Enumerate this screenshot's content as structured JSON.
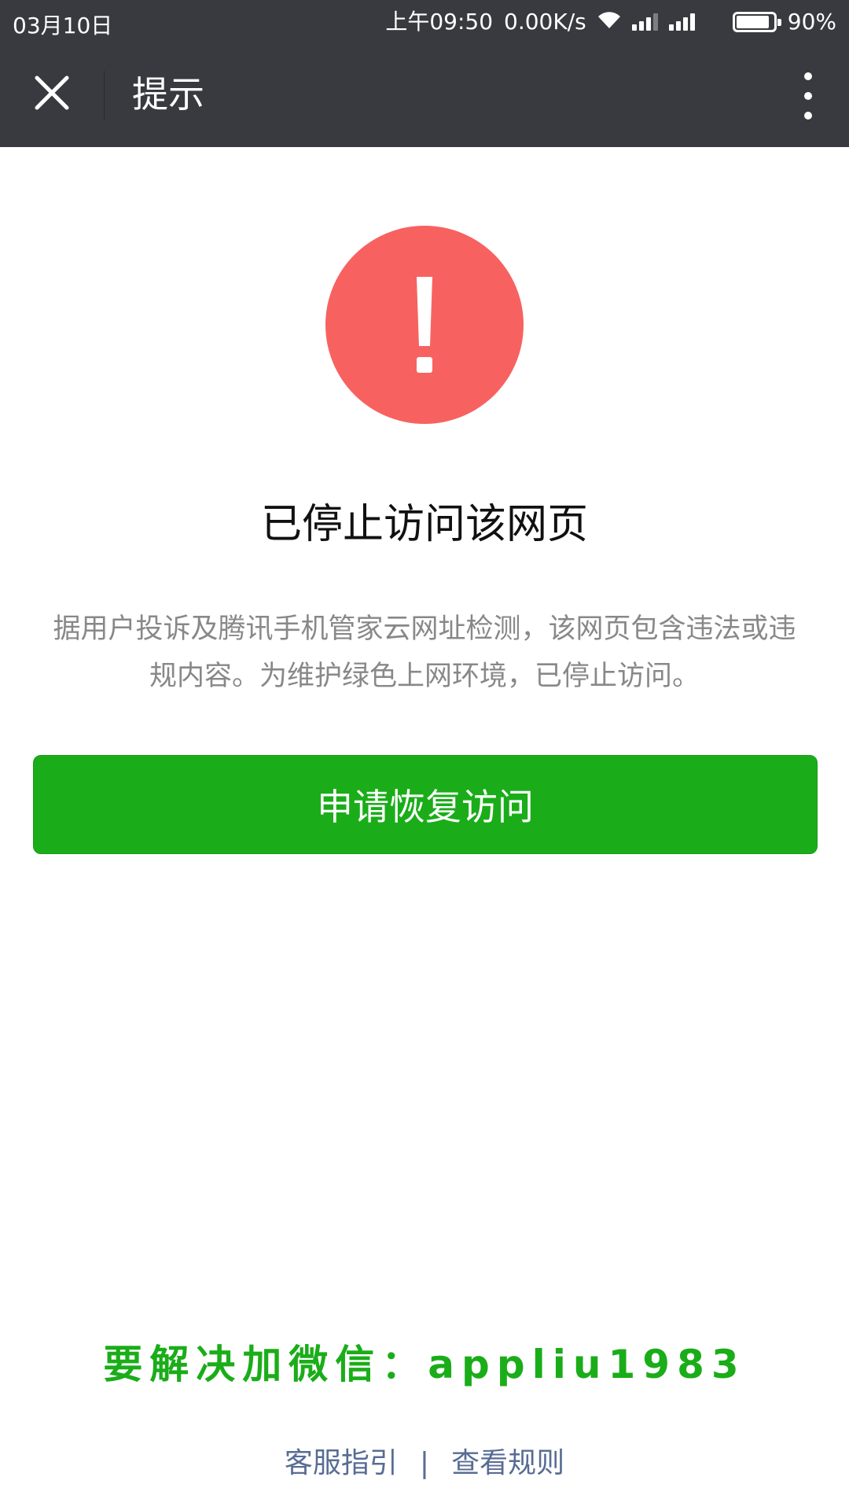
{
  "status_bar": {
    "date": "03月10日",
    "time": "上午09:50",
    "network_speed": "0.00K/s",
    "battery_percent": "90%",
    "battery_level": 0.9,
    "icons": [
      "wifi-icon",
      "signal-icon",
      "signal-icon",
      "battery-icon"
    ]
  },
  "nav_bar": {
    "close_icon": "close-icon",
    "title": "提示",
    "more_icon": "more-vertical-icon"
  },
  "warning": {
    "icon": "exclamation-icon",
    "color": "#f76260",
    "title": "已停止访问该网页",
    "description": "据用户投诉及腾讯手机管家云网址检测，该网页包含违法或违规内容。为维护绿色上网环境，已停止访问。"
  },
  "actions": {
    "restore_label": "申请恢复访问",
    "restore_color": "#1aad19"
  },
  "promo_text": "要解决加微信：appliu1983",
  "footer": {
    "help_label": "客服指引",
    "separator": "|",
    "rules_label": "查看规则",
    "link_color": "#586c94"
  }
}
